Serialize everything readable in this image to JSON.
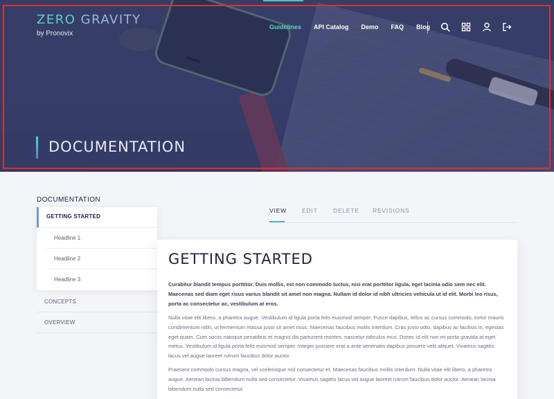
{
  "brand": {
    "name_part1": "ZER",
    "name_o": "O",
    "name_part2": "GRAVITY",
    "byline": "by Pronovix"
  },
  "nav": {
    "links": [
      "Guidelines",
      "API Catalog",
      "Demo",
      "FAQ",
      "Blog"
    ],
    "active": "Guidelines",
    "icons": [
      "search-icon",
      "grid-icon",
      "user-icon",
      "logout-icon"
    ]
  },
  "hero": {
    "title": "DOCUMENTATION"
  },
  "sidebar": {
    "heading": "DOCUMENTATION",
    "active_item": "GETTING STARTED",
    "subitems": [
      "Headline 1",
      "Headline 2",
      "Headline 3"
    ],
    "items": [
      "CONCEPTS",
      "OVERVIEW"
    ]
  },
  "tabs": [
    "VIEW",
    "EDIT",
    "DELETE",
    "REVISIONS"
  ],
  "content": {
    "title": "GETTING STARTED",
    "lead": "Curabitur blandit tempus porttitor. Duis mollis, est non commodo luctus, nisi erat porttitor ligula, eget lacinia odio sem nec elit. Maecenas sed diam eget risus varius blandit sit amet non magna. Nullam id dolor id nibh ultricies vehicula ut id elit. Morbi leo risus, porta ac consectetur ac, vestibulum at eros.",
    "paragraphs": [
      "Nulla vitae elit libero, a pharetra augue. Vestibulum id ligula porta felis euismod semper. Fusce dapibus, tellus ac cursus commodo, tortor mauris condimentum nibh, ut fermentum massa justo sit amet risus. Maecenas faucibus mollis interdum. Cras justo odio, dapibus ac facilisis in, egestas eget quam. Cum sociis natoque penatibus et magnis dis parturient montes, nascetur ridiculus mus. Donec id elit non mi porta gravida at eget metus. Vestibulum id ligula porta felis euismod semper. Integer posuere erat a ante venenatis dapibus posuere velit aliquet. Vivamus sagittis lacus vel augue laoreet rutrum faucibus dolor auctor.",
      "Praesent commodo cursus magna, vel scelerisque nisl consectetur et. Maecenas faucibus mollis interdum. Nulla vitae elit libero, a pharetra augue. Aenean lacinia bibendum nulla sed consectetur. Vivamus sagittis lacus vel augue laoreet rutrum faucibus dolor auctor. Aenean lacinia bibendum nulla sed consectetur."
    ]
  },
  "colors": {
    "accent": "#59d7c3",
    "hero_overlay": "#3a4268",
    "highlight_frame": "#e0302e"
  }
}
